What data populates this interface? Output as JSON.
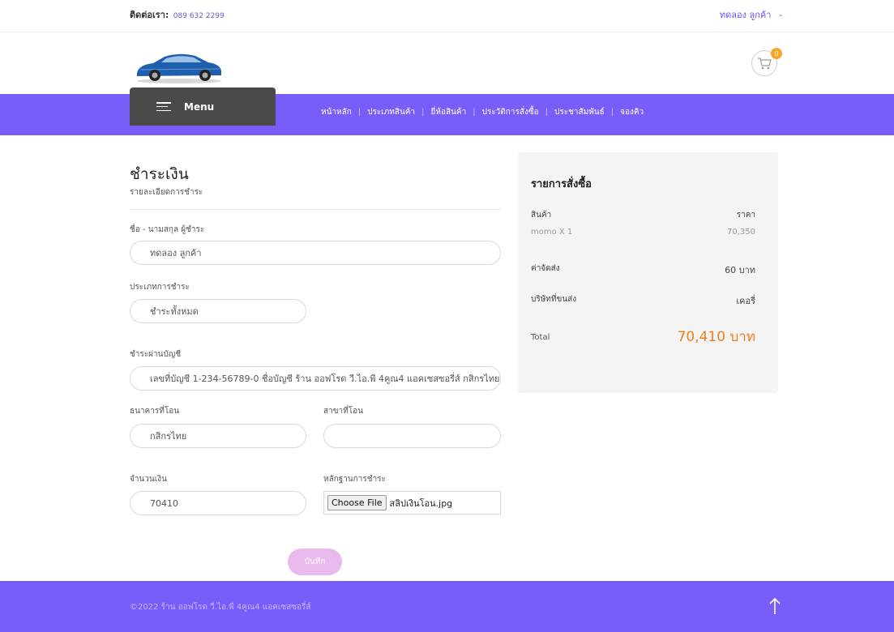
{
  "topbar": {
    "contact_label": "ติดต่อเรา:",
    "contact_phone": "089 632 2299",
    "user_name": "ทดลอง ลูกค้า"
  },
  "header": {
    "cart_count": "0",
    "menu_label": "Menu"
  },
  "nav": {
    "items": [
      "หน้าหลัก",
      "ประเภทสินค้า",
      "ยี่ห้อสินค้า",
      "ประวัติการสั่งซื้อ",
      "ประชาสัมพันธ์",
      "จองคิว"
    ]
  },
  "form": {
    "title": "ชำระเงิน",
    "subtitle": "รายละเอียดการชำระ",
    "name_label": "ชื่อ - นามสกุล ผู้ชำระ",
    "name_value": "ทดลอง ลูกค้า",
    "pay_type_label": "ประเภทการชำระ",
    "pay_type_value": "ชำระทั้งหมด",
    "account_label": "ชำระผ่านบัญชี",
    "account_value": "เลขที่บัญชี 1-234-56789-0 ชื่อบัญชี ร้าน ออฟโรด วี.ไอ.พี 4คูณ4 แอคเซสซอรี่ส์ กสิกรไทย",
    "bank_label": "ธนาคารที่โอน",
    "bank_value": "กสิกรไทย",
    "branch_label": "สาขาที่โอน",
    "branch_value": "",
    "amount_label": "จำนวนเงิน",
    "amount_value": "70410",
    "proof_label": "หลักฐานการชำระ",
    "file_button": "Choose File",
    "file_name": "สลิปเงินโอน.jpg",
    "save_label": "บันทึก"
  },
  "summary": {
    "title": "รายการสั่งซื้อ",
    "col_product": "สินค้า",
    "col_price": "ราคา",
    "item_name": "momo X 1",
    "item_price": "70,350",
    "shipping_label": "ค่าจัดส่ง",
    "shipping_value": "60 บาท",
    "carrier_label": "บริษัทที่ขนส่ง",
    "carrier_value": "เคอรี่",
    "total_label": "Total",
    "total_value": "70,410 บาท"
  },
  "footer": {
    "copyright": "©2022 ร้าน ออฟโรด วี.ไอ.พี 4คูณ4 แอคเซสซอรี่ส์"
  },
  "colors": {
    "brand_purple": "#7a5cf9",
    "menu_dark": "#4a4a4a",
    "total_orange": "#f07e1c",
    "save_pink": "#e9b8ec",
    "badge_orange": "#f5a623"
  },
  "icons": [
    "hamburger-icon",
    "cart-icon",
    "chevron-down-icon",
    "arrow-up-icon"
  ]
}
